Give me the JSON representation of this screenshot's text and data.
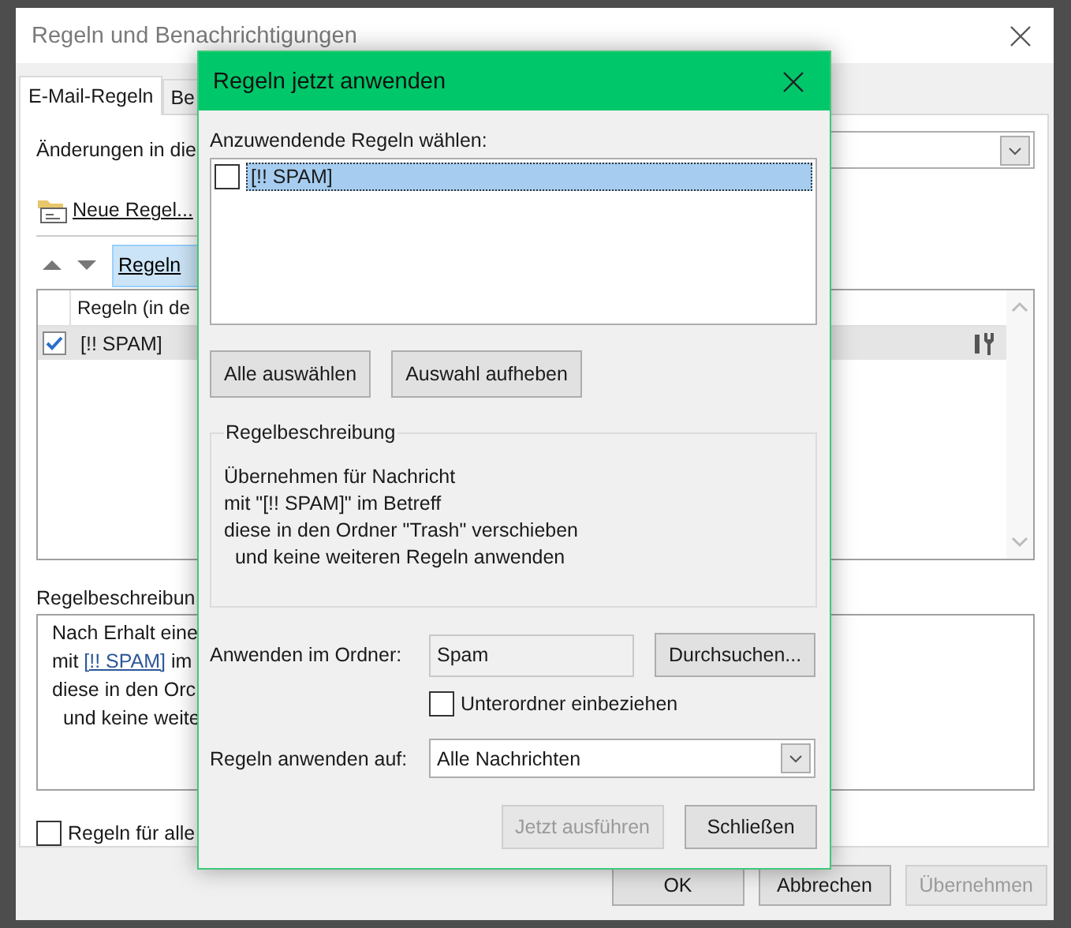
{
  "window": {
    "title": "Regeln und Benachrichtigungen"
  },
  "tabs": [
    {
      "label": "E-Mail-Regeln",
      "selected": true
    },
    {
      "label": "Be",
      "selected": false
    }
  ],
  "apply_changes_label": "Änderungen in die",
  "toolbar": {
    "new_rule": "Neue Regel...",
    "rules_button": "Regeln"
  },
  "rules_table": {
    "column": "Regeln (in de",
    "rows": [
      {
        "name": "[!! SPAM]",
        "checked": true,
        "selected": true
      }
    ]
  },
  "description": {
    "label": "Regelbeschreibun",
    "lines": [
      {
        "text": "Nach Erhalt eine"
      },
      {
        "text": "mit ",
        "link": "[!! SPAM]",
        "after": " im"
      },
      {
        "text": "diese in den Orc"
      },
      {
        "text": "  und keine weite"
      }
    ]
  },
  "apply_all": {
    "label": "Regeln für alle",
    "checked": false
  },
  "buttons": [
    {
      "label": "OK",
      "disabled": false
    },
    {
      "label": "Abbrechen",
      "disabled": false
    },
    {
      "label": "Übernehmen",
      "disabled": true
    }
  ],
  "dialog": {
    "title": "Regeln jetzt anwenden",
    "list_label": "Anzuwendende Regeln wählen:",
    "rules": [
      {
        "name": "[!! SPAM]",
        "checked": false,
        "selected": true
      }
    ],
    "select_buttons": [
      "Alle auswählen",
      "Auswahl aufheben"
    ],
    "description_title": "Regelbeschreibung",
    "description_lines": [
      "Übernehmen für Nachricht",
      "mit \"[!! SPAM]\" im Betreff",
      "diese in den Ordner \"Trash\" verschieben",
      "  und keine weiteren Regeln anwenden"
    ],
    "folder_label": "Anwenden im Ordner:",
    "folder_value": "Spam",
    "browse_button": "Durchsuchen...",
    "subfolders": {
      "label": "Unterordner einbeziehen",
      "checked": false
    },
    "apply_to_label": "Regeln anwenden auf:",
    "apply_to_value": "Alle Nachrichten",
    "buttons": [
      {
        "label": "Jetzt ausführen",
        "disabled": true
      },
      {
        "label": "Schließen",
        "disabled": false
      }
    ]
  }
}
